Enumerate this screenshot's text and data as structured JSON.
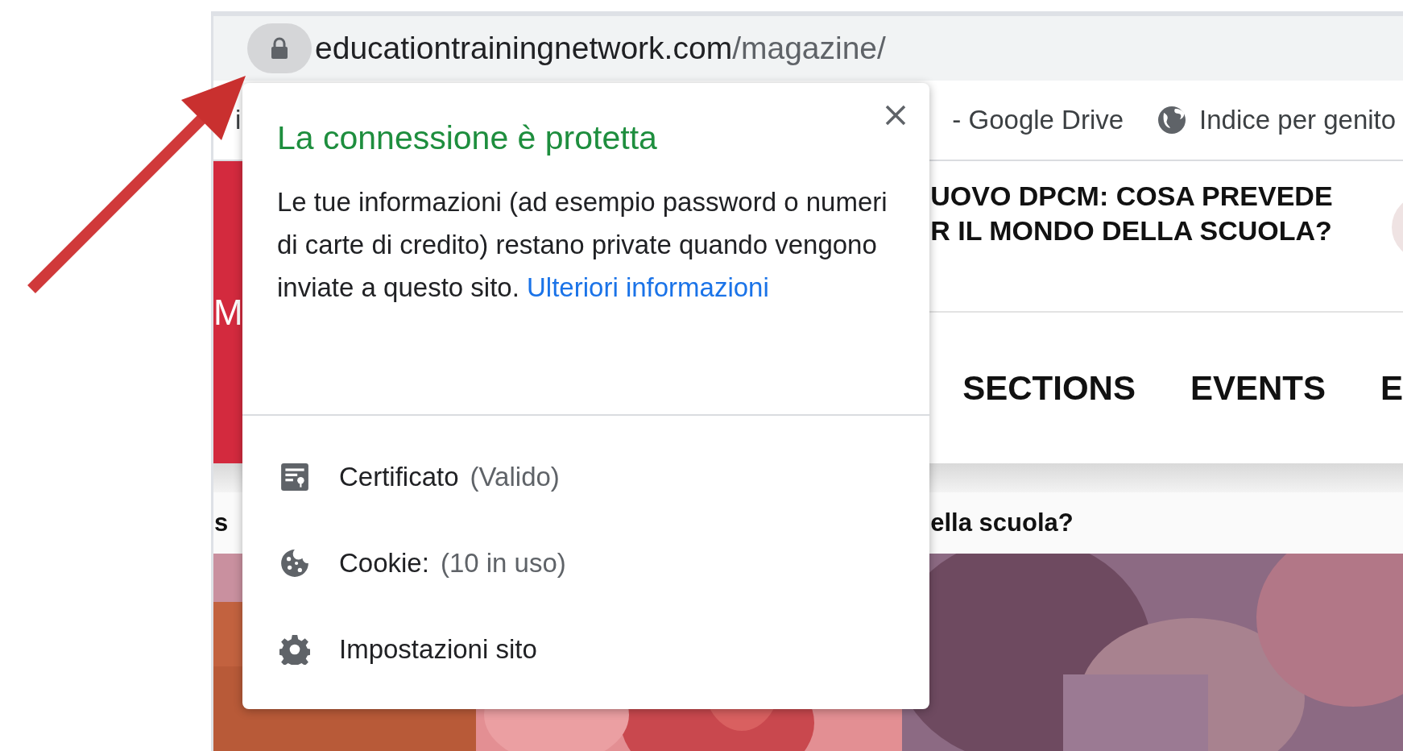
{
  "browser": {
    "secure": true,
    "url_host": "educationtrainingnetwork.com",
    "url_path": "/magazine/"
  },
  "bookmarks": [
    {
      "label": "i",
      "kind": "text"
    },
    {
      "label": "- Google Drive",
      "kind": "text"
    },
    {
      "label": "Indice per genito",
      "kind": "globe"
    }
  ],
  "page": {
    "logo_text": "M",
    "headline_lines": [
      "UOVO DPCM: COSA PREVEDE",
      "R IL MONDO DELLA SCUOLA?"
    ],
    "nav": [
      "SECTIONS",
      "EVENTS",
      "E"
    ],
    "ticker": [
      "s",
      "ella scuola?"
    ],
    "pictures": [
      {
        "kind": "picture"
      },
      {
        "kind": "picture"
      },
      {
        "kind": "picture"
      }
    ]
  },
  "popup": {
    "title": "La connessione è protetta",
    "body": "Le tue informazioni (ad esempio password o numeri di carte di credito) restano private quando vengono inviate a questo sito.",
    "link": "Ulteriori informazioni",
    "items": [
      {
        "kind": "certificate",
        "label": "Certificato",
        "detail": "(Valido)"
      },
      {
        "kind": "cookie",
        "label": "Cookie:",
        "detail": "(10 in uso)"
      },
      {
        "kind": "settings",
        "label": "Impostazioni sito"
      }
    ]
  }
}
